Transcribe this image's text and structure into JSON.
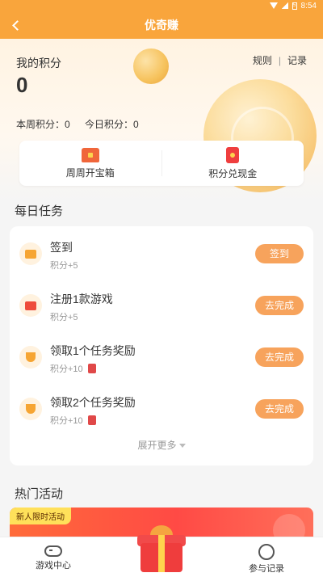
{
  "status_bar": {
    "time": "8:54",
    "battery": "5"
  },
  "nav": {
    "title": "优奇赚"
  },
  "points": {
    "label": "我的积分",
    "value": "0",
    "week_label": "本周积分：0",
    "today_label": "今日积分：0",
    "rules": "规则",
    "separator": "|",
    "records": "记录"
  },
  "quick_actions": [
    {
      "label": "周周开宝箱",
      "icon": "treasure-chest-icon"
    },
    {
      "label": "积分兑现金",
      "icon": "red-packet-icon"
    }
  ],
  "daily_tasks": {
    "title": "每日任务",
    "items": [
      {
        "title": "签到",
        "reward": "积分+5",
        "button": "签到",
        "icon": "calendar-check-icon"
      },
      {
        "title": "注册1款游戏",
        "reward": "积分+5",
        "button": "去完成",
        "icon": "game-controller-icon"
      },
      {
        "title": "领取1个任务奖励",
        "reward": "积分+10",
        "button": "去完成",
        "icon": "trophy-icon"
      },
      {
        "title": "领取2个任务奖励",
        "reward": "积分+10",
        "button": "去完成",
        "icon": "trophy-icon"
      }
    ],
    "more": "展开更多"
  },
  "hot": {
    "title": "热门活动",
    "banner_tag": "新人限时活动"
  },
  "tabbar": {
    "game_center": "游戏中心",
    "activities": "参与记录"
  },
  "colors": {
    "primary": "#f9a53c",
    "button": "#f7a35c"
  }
}
